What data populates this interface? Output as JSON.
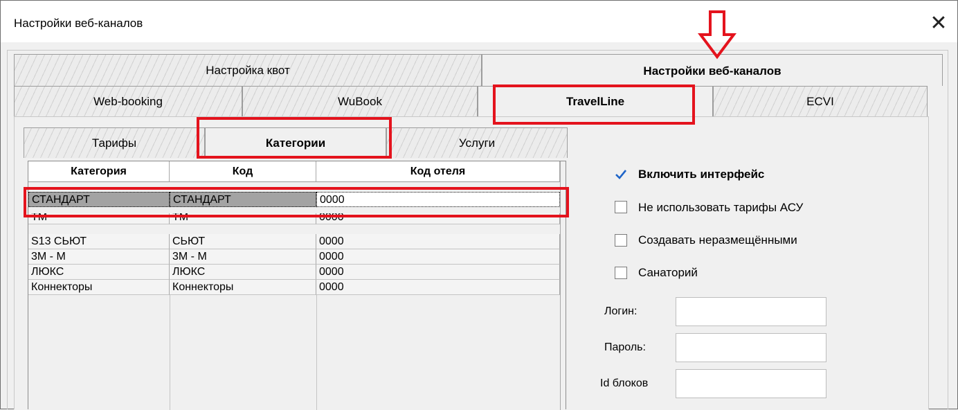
{
  "window": {
    "title": "Настройки веб-каналов",
    "close_label": "✕"
  },
  "top_tabs": [
    {
      "label": "Настройка квот",
      "active": false
    },
    {
      "label": "Настройки веб-каналов",
      "active": true
    }
  ],
  "channel_tabs": [
    {
      "label": "Web-booking",
      "active": false
    },
    {
      "label": "WuBook",
      "active": false
    },
    {
      "label": "TravelLine",
      "active": true
    },
    {
      "label": "ECVI",
      "active": false
    }
  ],
  "sub_tabs": [
    {
      "label": "Тарифы",
      "active": false
    },
    {
      "label": "Категории",
      "active": true
    },
    {
      "label": "Услуги",
      "active": false
    }
  ],
  "grid": {
    "columns": [
      "Категория",
      "Код",
      "Код отеля"
    ],
    "rows": [
      [
        "СТАНДАРТ",
        "СТАНДАРТ",
        "0000"
      ],
      [
        "ТМ",
        "ТМ",
        "0000"
      ],
      [
        "S13 СЬЮТ",
        "СЬЮТ",
        "0000"
      ],
      [
        "3М - М",
        "3М - М",
        "0000"
      ],
      [
        "ЛЮКС",
        "ЛЮКС",
        "0000"
      ],
      [
        "Коннекторы",
        "Коннекторы",
        "0000"
      ]
    ],
    "selected_row": 0
  },
  "options": {
    "enable_interface": {
      "label": "Включить интерфейс",
      "checked": true
    },
    "no_asu_rates": {
      "label": "Не использовать тарифы АСУ",
      "checked": false
    },
    "create_unplaced": {
      "label": "Создавать неразмещёнными",
      "checked": false
    },
    "sanatorium": {
      "label": "Санаторий",
      "checked": false
    }
  },
  "fields": {
    "login": {
      "label": "Логин:",
      "value": ""
    },
    "password": {
      "label": "Пароль:",
      "value": ""
    },
    "block_id": {
      "label": "Id блоков",
      "value": ""
    }
  },
  "colors": {
    "highlight_red": "#e4131d",
    "check_blue": "#1e64c8",
    "selected_row": "#a3a3a3"
  },
  "arrow_icon": "down-arrow-outline-icon"
}
